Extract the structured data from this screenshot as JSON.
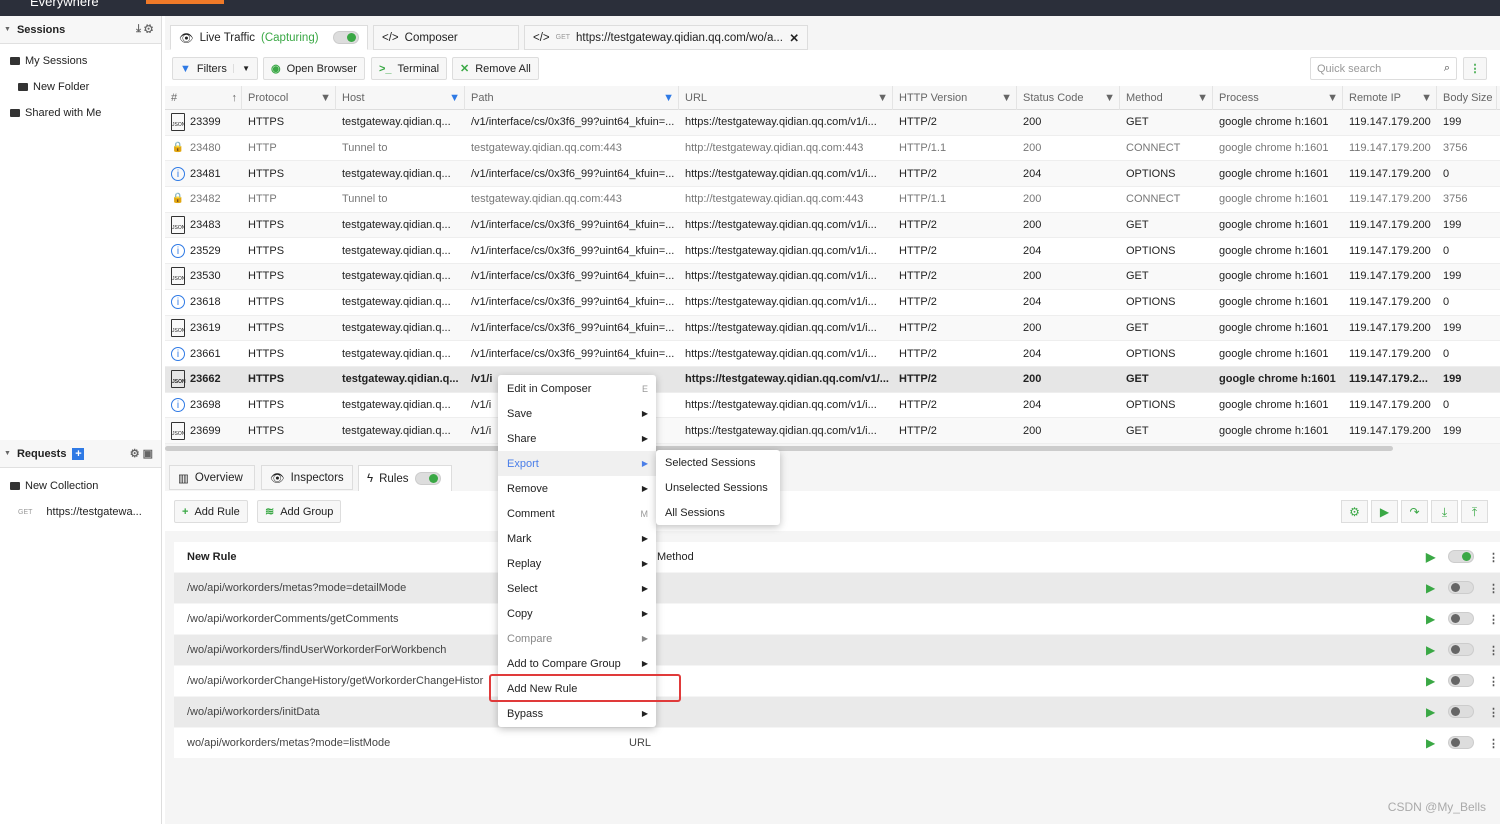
{
  "app": {
    "title": "Everywhere"
  },
  "sidebar": {
    "sessions_label": "Sessions",
    "items": [
      "My Sessions",
      "New Folder",
      "Shared with Me"
    ],
    "requests_label": "Requests",
    "collection": "New Collection",
    "req_method": "GET",
    "req_url": "https://testgatewa..."
  },
  "tabs": {
    "live": "Live Traffic",
    "capturing": "(Capturing)",
    "composer": "Composer",
    "req_method": "GET",
    "req_url": "https://testgateway.qidian.qq.com/wo/a..."
  },
  "toolbar": {
    "filters": "Filters",
    "open_browser": "Open Browser",
    "terminal": "Terminal",
    "remove_all": "Remove All",
    "search_placeholder": "Quick search"
  },
  "columns": [
    "#",
    "Protocol",
    "Host",
    "Path",
    "URL",
    "HTTP Version",
    "Status Code",
    "Method",
    "Process",
    "Remote IP",
    "Body Size"
  ],
  "rows": [
    {
      "icon": "json",
      "cells": [
        "23399",
        "HTTPS",
        "testgateway.qidian.q...",
        "/v1/interface/cs/0x3f6_99?uint64_kfuin=...",
        "https://testgateway.qidian.qq.com/v1/i...",
        "HTTP/2",
        "200",
        "GET",
        "google chrome h:1601",
        "119.147.179.200",
        "199"
      ]
    },
    {
      "icon": "lock",
      "cells": [
        "23480",
        "HTTP",
        "Tunnel to",
        "testgateway.qidian.qq.com:443",
        "http://testgateway.qidian.qq.com:443",
        "HTTP/1.1",
        "200",
        "CONNECT",
        "google chrome h:1601",
        "119.147.179.200",
        "3756"
      ]
    },
    {
      "icon": "info",
      "cells": [
        "23481",
        "HTTPS",
        "testgateway.qidian.q...",
        "/v1/interface/cs/0x3f6_99?uint64_kfuin=...",
        "https://testgateway.qidian.qq.com/v1/i...",
        "HTTP/2",
        "204",
        "OPTIONS",
        "google chrome h:1601",
        "119.147.179.200",
        "0"
      ]
    },
    {
      "icon": "lock",
      "cells": [
        "23482",
        "HTTP",
        "Tunnel to",
        "testgateway.qidian.qq.com:443",
        "http://testgateway.qidian.qq.com:443",
        "HTTP/1.1",
        "200",
        "CONNECT",
        "google chrome h:1601",
        "119.147.179.200",
        "3756"
      ]
    },
    {
      "icon": "json",
      "cells": [
        "23483",
        "HTTPS",
        "testgateway.qidian.q...",
        "/v1/interface/cs/0x3f6_99?uint64_kfuin=...",
        "https://testgateway.qidian.qq.com/v1/i...",
        "HTTP/2",
        "200",
        "GET",
        "google chrome h:1601",
        "119.147.179.200",
        "199"
      ]
    },
    {
      "icon": "info",
      "cells": [
        "23529",
        "HTTPS",
        "testgateway.qidian.q...",
        "/v1/interface/cs/0x3f6_99?uint64_kfuin=...",
        "https://testgateway.qidian.qq.com/v1/i...",
        "HTTP/2",
        "204",
        "OPTIONS",
        "google chrome h:1601",
        "119.147.179.200",
        "0"
      ]
    },
    {
      "icon": "json",
      "cells": [
        "23530",
        "HTTPS",
        "testgateway.qidian.q...",
        "/v1/interface/cs/0x3f6_99?uint64_kfuin=...",
        "https://testgateway.qidian.qq.com/v1/i...",
        "HTTP/2",
        "200",
        "GET",
        "google chrome h:1601",
        "119.147.179.200",
        "199"
      ]
    },
    {
      "icon": "info",
      "cells": [
        "23618",
        "HTTPS",
        "testgateway.qidian.q...",
        "/v1/interface/cs/0x3f6_99?uint64_kfuin=...",
        "https://testgateway.qidian.qq.com/v1/i...",
        "HTTP/2",
        "204",
        "OPTIONS",
        "google chrome h:1601",
        "119.147.179.200",
        "0"
      ]
    },
    {
      "icon": "json",
      "cells": [
        "23619",
        "HTTPS",
        "testgateway.qidian.q...",
        "/v1/interface/cs/0x3f6_99?uint64_kfuin=...",
        "https://testgateway.qidian.qq.com/v1/i...",
        "HTTP/2",
        "200",
        "GET",
        "google chrome h:1601",
        "119.147.179.200",
        "199"
      ]
    },
    {
      "icon": "info",
      "cells": [
        "23661",
        "HTTPS",
        "testgateway.qidian.q...",
        "/v1/interface/cs/0x3f6_99?uint64_kfuin=...",
        "https://testgateway.qidian.qq.com/v1/i...",
        "HTTP/2",
        "204",
        "OPTIONS",
        "google chrome h:1601",
        "119.147.179.200",
        "0"
      ]
    },
    {
      "icon": "json",
      "selected": true,
      "cells": [
        "23662",
        "HTTPS",
        "testgateway.qidian.q...",
        "/v1/i",
        "https://testgateway.qidian.qq.com/v1/...",
        "HTTP/2",
        "200",
        "GET",
        "google chrome h:1601",
        "119.147.179.2...",
        "199"
      ]
    },
    {
      "icon": "info",
      "cells": [
        "23698",
        "HTTPS",
        "testgateway.qidian.q...",
        "/v1/i",
        "https://testgateway.qidian.qq.com/v1/i...",
        "HTTP/2",
        "204",
        "OPTIONS",
        "google chrome h:1601",
        "119.147.179.200",
        "0"
      ]
    },
    {
      "icon": "json",
      "cells": [
        "23699",
        "HTTPS",
        "testgateway.qidian.q...",
        "/v1/i",
        "https://testgateway.qidian.qq.com/v1/i...",
        "HTTP/2",
        "200",
        "GET",
        "google chrome h:1601",
        "119.147.179.200",
        "199"
      ]
    }
  ],
  "bottom_tabs": {
    "overview": "Overview",
    "inspectors": "Inspectors",
    "rules": "Rules"
  },
  "rules_toolbar": {
    "add_rule": "Add Rule",
    "add_group": "Add Group"
  },
  "rules": {
    "header": "New Rule",
    "header_col": "Method",
    "items": [
      {
        "path": "/wo/api/workorders/metas?mode=detailMode",
        "col": "",
        "enabled": false
      },
      {
        "path": "/wo/api/workorderComments/getComments",
        "col": "",
        "enabled": false
      },
      {
        "path": "/wo/api/workorders/findUserWorkorderForWorkbench",
        "col": "",
        "enabled": false
      },
      {
        "path": "/wo/api/workorderChangeHistory/getWorkorderChangeHistor",
        "col": "",
        "enabled": false
      },
      {
        "path": "/wo/api/workorders/initData",
        "col": "",
        "enabled": false
      },
      {
        "path": "wo/api/workorders/metas?mode=listMode",
        "col": "URL",
        "enabled": false
      }
    ]
  },
  "context_menu": [
    {
      "label": "Edit in Composer",
      "shortcut": "E"
    },
    {
      "label": "Save",
      "arrow": true
    },
    {
      "label": "Share",
      "arrow": true
    },
    {
      "label": "Export",
      "arrow": true,
      "highlight": true
    },
    {
      "label": "Remove",
      "arrow": true
    },
    {
      "label": "Comment",
      "shortcut": "M"
    },
    {
      "label": "Mark",
      "arrow": true
    },
    {
      "label": "Replay",
      "arrow": true
    },
    {
      "label": "Select",
      "arrow": true
    },
    {
      "label": "Copy",
      "arrow": true
    },
    {
      "label": "Compare",
      "arrow": true,
      "disabled": true
    },
    {
      "label": "Add to Compare Group",
      "arrow": true
    },
    {
      "label": "Add New Rule"
    },
    {
      "label": "Bypass",
      "arrow": true
    }
  ],
  "submenu": [
    "Selected Sessions",
    "Unselected Sessions",
    "All Sessions"
  ],
  "watermark": "CSDN @My_Bells",
  "colors": {
    "accent": "#3aa845",
    "link": "#2f7ae5",
    "highlight_box": "#e03a3a"
  }
}
